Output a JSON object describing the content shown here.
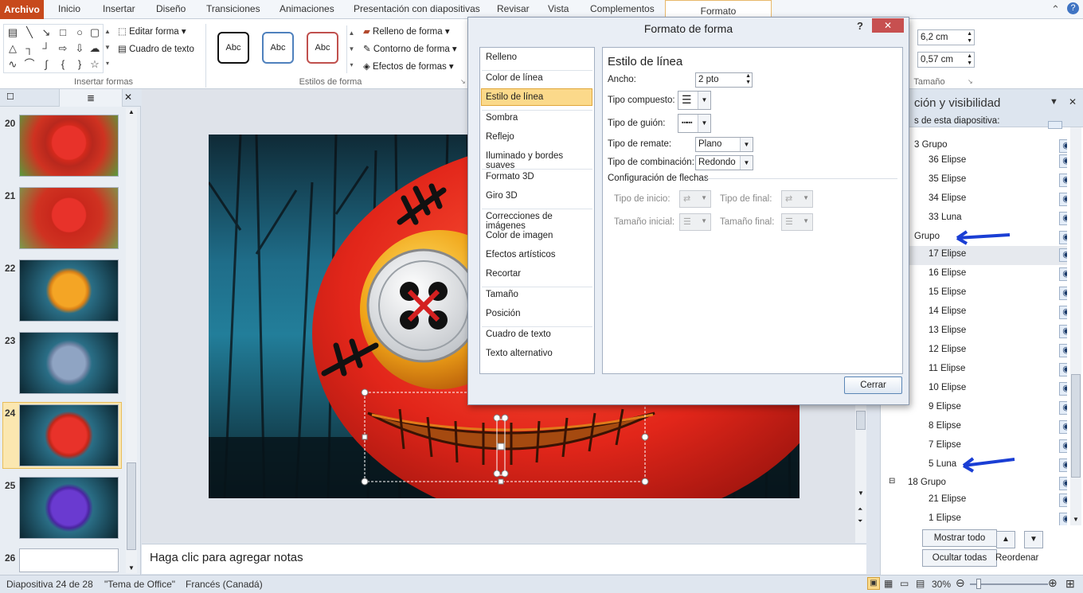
{
  "tabs": [
    "Archivo",
    "Inicio",
    "Insertar",
    "Diseño",
    "Transiciones",
    "Animaciones",
    "Presentación con diapositivas",
    "Revisar",
    "Vista",
    "Complementos",
    "Formato"
  ],
  "ribbon": {
    "editar_forma": "Editar forma",
    "cuadro_texto": "Cuadro de texto",
    "insertar_formas": "Insertar formas",
    "abc": "Abc",
    "relleno": "Relleno de forma",
    "contorno": "Contorno de forma",
    "efectos": "Efectos de formas",
    "estilos_forma": "Estilos de forma",
    "height": "6,2 cm",
    "width": "0,57 cm",
    "tamano": "Tamaño"
  },
  "slides": [
    "20",
    "21",
    "22",
    "23",
    "24",
    "25",
    "26"
  ],
  "notes_placeholder": "Haga clic para agregar notas",
  "dialog": {
    "title": "Formato de forma",
    "help": "?",
    "close_x": "✕",
    "categories": [
      "Relleno",
      "Color de línea",
      "Estilo de línea",
      "Sombra",
      "Reflejo",
      "Iluminado y bordes suaves",
      "Formato 3D",
      "Giro 3D",
      "Correcciones de imágenes",
      "Color de imagen",
      "Efectos artísticos",
      "Recortar",
      "Tamaño",
      "Posición",
      "Cuadro de texto",
      "Texto alternativo"
    ],
    "section_title": "Estilo de línea",
    "ancho_label": "Ancho:",
    "ancho_value": "2 pto",
    "compuesto_label": "Tipo compuesto:",
    "guion_label": "Tipo de guión:",
    "remate_label": "Tipo de remate:",
    "remate_value": "Plano",
    "combinacion_label": "Tipo de combinación:",
    "combinacion_value": "Redondo",
    "flechas_title": "Configuración de flechas",
    "inicio_label": "Tipo de inicio:",
    "final_label": "Tipo de final:",
    "tam_inicial_label": "Tamaño inicial:",
    "tam_final_label": "Tamaño final:",
    "cerrar": "Cerrar"
  },
  "pane": {
    "title": "ción y visibilidad",
    "subtitle": "s de esta diapositiva:",
    "items": [
      "3 Grupo",
      "36 Elipse",
      "35 Elipse",
      "34 Elipse",
      "33 Luna",
      "Grupo",
      "17 Elipse",
      "16 Elipse",
      "15 Elipse",
      "14 Elipse",
      "13 Elipse",
      "12 Elipse",
      "11 Elipse",
      "10 Elipse",
      "9 Elipse",
      "8 Elipse",
      "7 Elipse",
      "5 Luna",
      "18 Grupo",
      "21 Elipse",
      "1 Elipse"
    ],
    "mostrar": "Mostrar todo",
    "ocultar": "Ocultar todas",
    "reordenar": "Reordenar"
  },
  "status": {
    "slide": "Diapositiva 24 de 28",
    "theme": "\"Tema de Office\"",
    "lang": "Francés (Canadá)",
    "zoom": "30%"
  },
  "colors": {
    "accent": "#c7491c",
    "selected": "#fbd98a",
    "arrow": "#1a3ed4"
  }
}
